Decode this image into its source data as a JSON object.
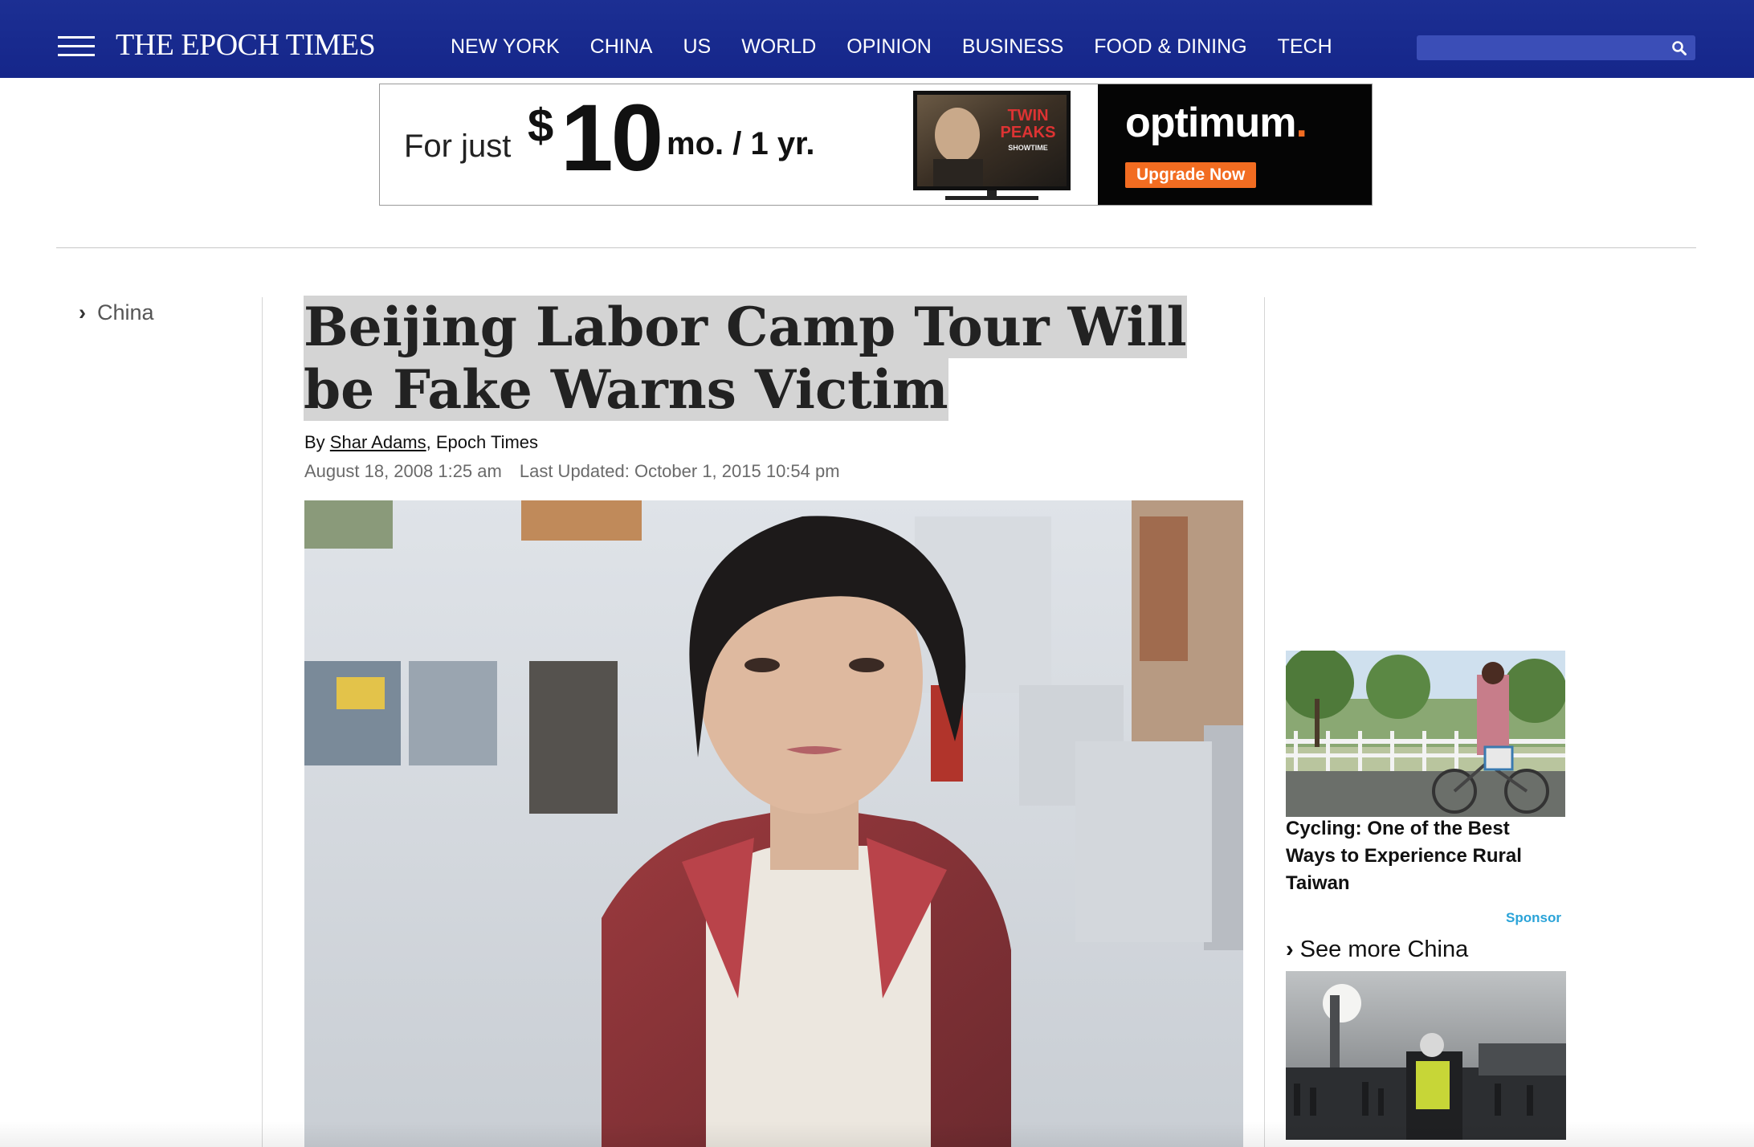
{
  "header": {
    "logo": "THE EPOCH TIMES",
    "nav": [
      "NEW YORK",
      "CHINA",
      "US",
      "WORLD",
      "OPINION",
      "BUSINESS",
      "FOOD & DINING",
      "TECH"
    ],
    "search_value": "",
    "colors": {
      "bar": "#1c2f93",
      "search": "#3b4eb7"
    }
  },
  "ad": {
    "prefix": "For just",
    "dollar": "$",
    "price": "10",
    "term": "mo. / 1 yr.",
    "tv_line1": "TWIN",
    "tv_line2": "PEAKS",
    "tv_network": "SHOWTIME",
    "brand": "optimum",
    "brand_dot": ".",
    "cta": "Upgrade Now",
    "colors": {
      "brand_orange": "#f26c21"
    }
  },
  "breadcrumb": {
    "label": "China"
  },
  "article": {
    "headline": "Beijing Labor Camp Tour Will be Fake Warns Victim",
    "byline_prefix": "By ",
    "author": "Shar Adams",
    "byline_suffix": ", Epoch Times",
    "published": "August 18, 2008 1:25 am",
    "updated": "Last Updated: October 1, 2015 10:54 pm"
  },
  "sidebar": {
    "promo_title": "Cycling: One of the Best Ways to Experience Rural Taiwan",
    "sponsor_label": "Sponsor",
    "see_more": "See more China",
    "colors": {
      "sponsor": "#2aa3d8"
    }
  }
}
